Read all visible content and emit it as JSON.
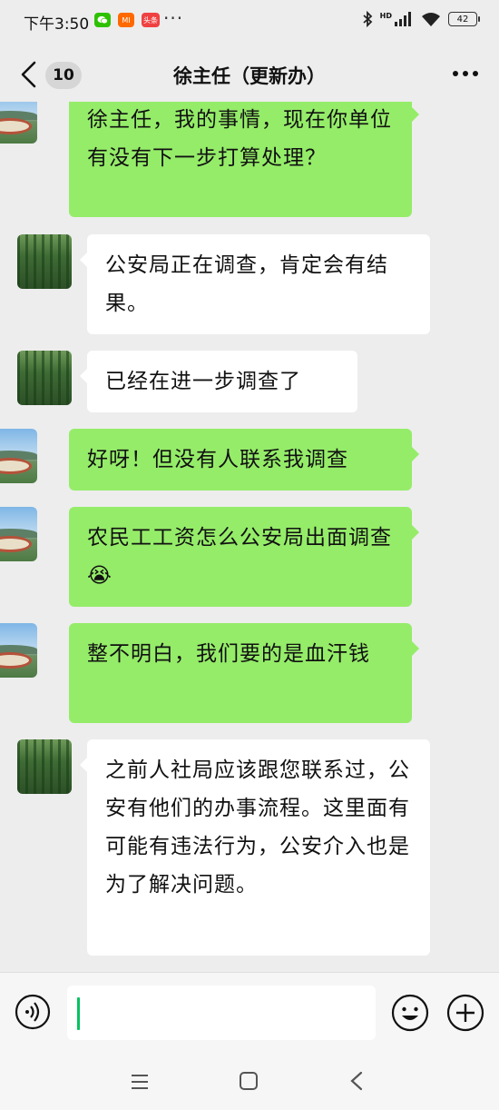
{
  "status_bar": {
    "time": "下午3:50",
    "apps": [
      {
        "name": "wechat-icon",
        "color": "#2dc100",
        "label": ""
      },
      {
        "name": "mi-icon",
        "color": "#ff6900",
        "label": "MI"
      },
      {
        "name": "toutiao-icon",
        "color": "#f04142",
        "label": "头条"
      }
    ],
    "more": "···",
    "network": "HD",
    "battery": "42"
  },
  "header": {
    "back_count": "10",
    "title": "徐主任（更新办）",
    "more_label": "···"
  },
  "messages": [
    {
      "side": "right",
      "text": "徐主任，我的事情，现在你单位有没有下一步打算处理？",
      "avatar": "landscape-avatar"
    },
    {
      "side": "left",
      "text": "公安局正在调查，肯定会有结果。",
      "avatar": "bamboo-avatar"
    },
    {
      "side": "left",
      "text": "已经在进一步调查了",
      "avatar": "bamboo-avatar"
    },
    {
      "side": "right",
      "text": "好呀！但没有人联系我调查",
      "avatar": "landscape-avatar"
    },
    {
      "side": "right",
      "text": "农民工工资怎么公安局出面调查😭",
      "avatar": "landscape-avatar"
    },
    {
      "side": "right",
      "text": "整不明白，我们要的是血汗钱",
      "avatar": "landscape-avatar"
    },
    {
      "side": "left",
      "text": "之前人社局应该跟您联系过，公安有他们的办事流程。这里面有可能有违法行为，公安介入也是为了解决问题。",
      "avatar": "bamboo-avatar"
    }
  ],
  "colors": {
    "background": "#ededed",
    "bubble_out": "#95ec69",
    "bubble_in": "#ffffff",
    "accent": "#07c160"
  },
  "input": {
    "value": "",
    "placeholder": ""
  }
}
